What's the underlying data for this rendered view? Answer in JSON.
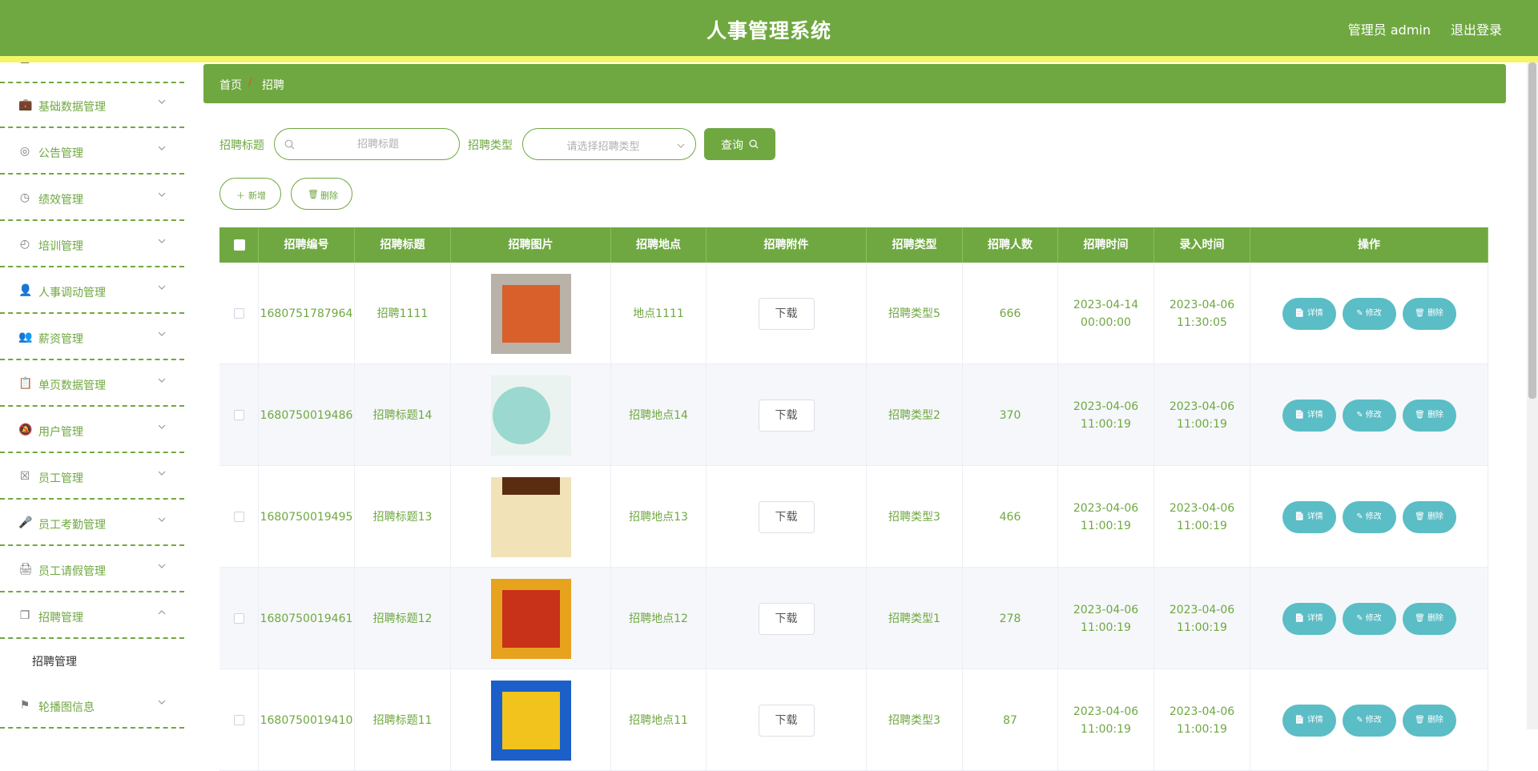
{
  "header": {
    "title": "人事管理系统",
    "admin": "管理员 admin",
    "logout": "退出登录"
  },
  "colors": {
    "primary": "#6fa840",
    "accent_stripe": "#f5f56a",
    "op_button": "#5bbdc6"
  },
  "sidebar": {
    "items": [
      {
        "label": "基础数据管理",
        "icon": "briefcase-icon"
      },
      {
        "label": "公告管理",
        "icon": "target-icon"
      },
      {
        "label": "绩效管理",
        "icon": "compass-icon"
      },
      {
        "label": "培训管理",
        "icon": "gauge-icon"
      },
      {
        "label": "人事调动管理",
        "icon": "user-icon"
      },
      {
        "label": "薪资管理",
        "icon": "user-group-icon"
      },
      {
        "label": "单页数据管理",
        "icon": "clipboard-icon"
      },
      {
        "label": "用户管理",
        "icon": "bell-off-icon"
      },
      {
        "label": "员工管理",
        "icon": "clipboard-x-icon"
      },
      {
        "label": "员工考勤管理",
        "icon": "microphone-icon"
      },
      {
        "label": "员工请假管理",
        "icon": "printer-icon"
      },
      {
        "label": "招聘管理",
        "icon": "copy-icon"
      }
    ],
    "sub_item": "招聘管理",
    "last_item": {
      "label": "轮播图信息",
      "icon": "flag-icon"
    }
  },
  "breadcrumb": {
    "home": "首页",
    "separator": "/",
    "current": "招聘"
  },
  "search": {
    "title_label": "招聘标题",
    "title_placeholder": "招聘标题",
    "type_label": "招聘类型",
    "type_placeholder": "请选择招聘类型",
    "query_label": "查询"
  },
  "actions": {
    "add": "新增",
    "delete": "删除"
  },
  "table": {
    "columns": [
      "招聘编号",
      "招聘标题",
      "招聘图片",
      "招聘地点",
      "招聘附件",
      "招聘类型",
      "招聘人数",
      "招聘时间",
      "录入时间",
      "操作"
    ],
    "download_label": "下载",
    "op_labels": {
      "detail": "详情",
      "edit": "修改",
      "delete": "删除"
    },
    "rows": [
      {
        "id": "1680751787964",
        "title": "招聘1111",
        "place": "地点1111",
        "type": "招聘类型5",
        "count": "666",
        "time": "2023-04-14 00:00:00",
        "created": "2023-04-06 11:30:05"
      },
      {
        "id": "1680750019486",
        "title": "招聘标题14",
        "place": "招聘地点14",
        "type": "招聘类型2",
        "count": "370",
        "time": "2023-04-06 11:00:19",
        "created": "2023-04-06 11:00:19"
      },
      {
        "id": "1680750019495",
        "title": "招聘标题13",
        "place": "招聘地点13",
        "type": "招聘类型3",
        "count": "466",
        "time": "2023-04-06 11:00:19",
        "created": "2023-04-06 11:00:19"
      },
      {
        "id": "1680750019461",
        "title": "招聘标题12",
        "place": "招聘地点12",
        "type": "招聘类型1",
        "count": "278",
        "time": "2023-04-06 11:00:19",
        "created": "2023-04-06 11:00:19"
      },
      {
        "id": "1680750019410",
        "title": "招聘标题11",
        "place": "招聘地点11",
        "type": "招聘类型3",
        "count": "87",
        "time": "2023-04-06 11:00:19",
        "created": "2023-04-06 11:00:19"
      }
    ]
  }
}
